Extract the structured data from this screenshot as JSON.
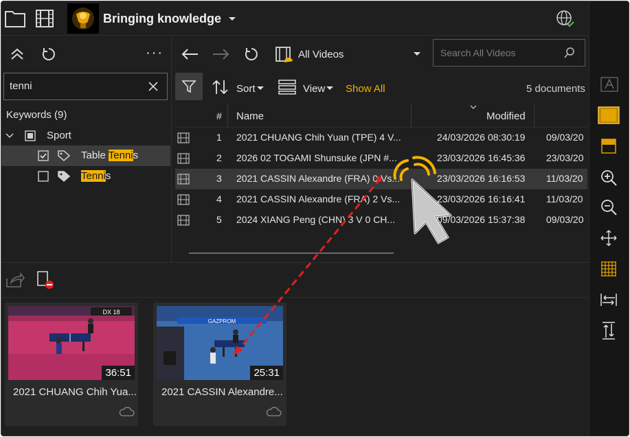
{
  "header": {
    "title": "Bringing knowledge"
  },
  "left": {
    "search_value": "tenni",
    "keywords_header": "Keywords (9)",
    "tree": {
      "root_label": "Sport",
      "child1_prefix": "Table ",
      "child1_hl": "Tenni",
      "child1_suffix": "s",
      "child2_hl": "Tenni",
      "child2_suffix": "s"
    }
  },
  "toolbar": {
    "source_label": "All Videos",
    "search_placeholder": "Search All Videos",
    "sort_label": "Sort",
    "view_label": "View",
    "show_all_label": "Show All",
    "doc_count": "5 documents"
  },
  "table": {
    "headers": {
      "num": "#",
      "name": "Name",
      "modified": "Modified"
    },
    "rows": [
      {
        "num": "1",
        "name": "2021 CHUANG Chih Yuan (TPE) 4 V...",
        "modified": "24/03/2026 08:30:19",
        "extra": "09/03/20"
      },
      {
        "num": "2",
        "name": "2026 02 TOGAMI Shunsuke (JPN #...",
        "modified": "23/03/2026 16:45:36",
        "extra": "23/03/20"
      },
      {
        "num": "3",
        "name": "2021 CASSIN Alexandre (FRA) 0 Vs...",
        "modified": "23/03/2026 16:16:53",
        "extra": "11/03/20"
      },
      {
        "num": "4",
        "name": "2021 CASSIN Alexandre (FRA) 2 Vs...",
        "modified": "23/03/2026 16:16:41",
        "extra": "11/03/20"
      },
      {
        "num": "5",
        "name": "2024  XIANG Peng (CHN) 3 V 0 CH...",
        "modified": "09/03/2026 15:37:38",
        "extra": "09/03/20"
      }
    ]
  },
  "bottom": {
    "cards": [
      {
        "title": "2021 CHUANG Chih Yua...",
        "duration": "36:51",
        "scoreboard": "DX 18"
      },
      {
        "title": "2021 CASSIN Alexandre...",
        "duration": "25:31",
        "banner": "GAZPROM"
      }
    ]
  },
  "colors": {
    "accent": "#f2b200",
    "background": "#1f1f1f",
    "arrow": "#e02020"
  }
}
